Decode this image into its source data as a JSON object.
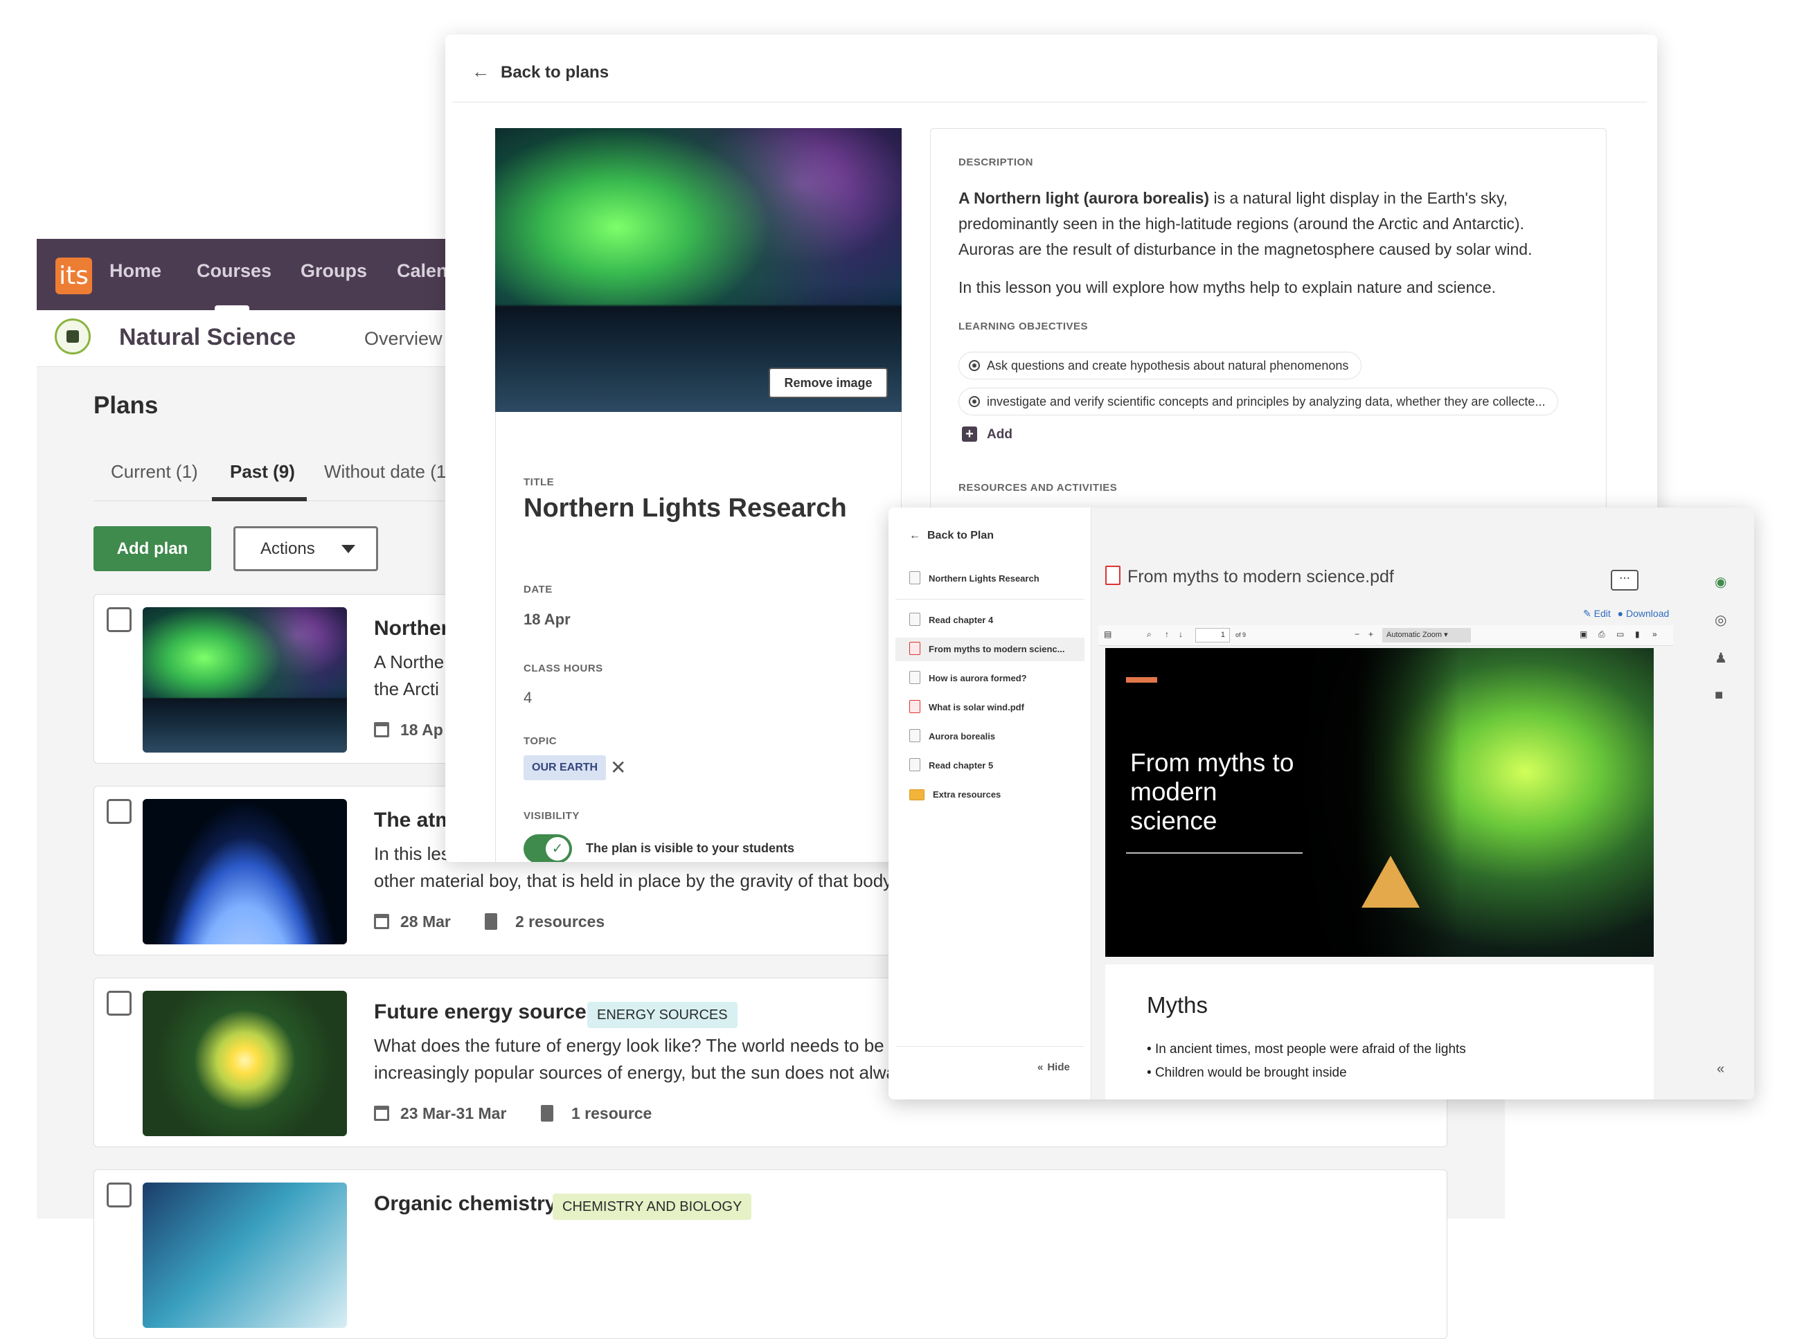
{
  "nav": {
    "logo": "its",
    "items": [
      "Home",
      "Courses",
      "Groups",
      "Calen"
    ]
  },
  "course": {
    "title": "Natural Science",
    "overview_tab": "Overview"
  },
  "plans": {
    "title": "Plans",
    "tabs": [
      "Current (1)",
      "Past (9)",
      "Without date (1"
    ],
    "add_label": "Add plan",
    "actions_label": "Actions",
    "cards": [
      {
        "title": "Norther",
        "desc": [
          "A Northe",
          "the Arcti"
        ],
        "date": "18 Ap"
      },
      {
        "title": "The atm",
        "desc": [
          "In this les",
          "other material boy, that is held in place by the gravity of that body"
        ],
        "date": "28 Mar",
        "resources": "2 resources"
      },
      {
        "title": "Future energy sources",
        "tag": "ENERGY SOURCES",
        "tag_bg": "#d8f0f1",
        "desc": [
          "What does the future of energy look like? The world needs to be",
          "increasingly popular sources of energy, but the sun does not alwa"
        ],
        "date": "23 Mar-31 Mar",
        "resources": "1 resource"
      },
      {
        "title": "Organic chemistry",
        "tag": "CHEMISTRY AND BIOLOGY",
        "tag_bg": "#e6f1c6"
      }
    ]
  },
  "editor": {
    "back_label": "Back to plans",
    "remove_image_label": "Remove image",
    "title_label": "TITLE",
    "title": "Northern Lights Research",
    "date_label": "DATE",
    "date": "18 Apr",
    "hours_label": "CLASS HOURS",
    "hours": "4",
    "topic_label": "TOPIC",
    "topic": "OUR EARTH",
    "visibility_label": "VISIBILITY",
    "visibility_text": "The plan is visible to your students",
    "visibility_on": true,
    "description_label": "DESCRIPTION",
    "description_bold": "A Northern light (aurora borealis)",
    "description_rest": " is a natural light display in the Earth's sky, predominantly seen in the high-latitude regions (around the Arctic and Antarctic). Auroras are the result of disturbance in the magnetosphere caused by solar wind.",
    "description_p2": "In this lesson you will explore how myths help to explain nature and science.",
    "objectives_label": "LEARNING OBJECTIVES",
    "objectives": [
      "Ask questions and create hypothesis about natural phenomenons",
      "investigate and verify scientific concepts and principles by analyzing data, whether they are collecte..."
    ],
    "add_label": "Add",
    "resources_label": "RESOURCES AND ACTIVITIES"
  },
  "viewer": {
    "back_label": "Back to Plan",
    "plan_name": "Northern Lights Research",
    "items": [
      {
        "label": "Read chapter 4",
        "kind": "task"
      },
      {
        "label": "From myths to modern scienc...",
        "kind": "pdf",
        "selected": true
      },
      {
        "label": "How is aurora formed?",
        "kind": "task"
      },
      {
        "label": "What is solar wind.pdf",
        "kind": "pdf"
      },
      {
        "label": "Aurora borealis",
        "kind": "image"
      },
      {
        "label": "Read chapter 5",
        "kind": "task"
      },
      {
        "label": "Extra resources",
        "kind": "folder"
      }
    ],
    "hide_label": "Hide",
    "file_name": "From myths to modern science.pdf",
    "more_label": "⋯",
    "edit_label": "Edit",
    "download_label": "Download",
    "page_current": "1",
    "page_total": "of 9",
    "zoom_label": "Automatic Zoom",
    "slide_title": "From myths to modern science",
    "slide2_heading": "Myths",
    "slide2_bullets": [
      "In ancient times, most people were afraid of the lights",
      "Children would be brought inside"
    ]
  },
  "colors": {
    "nav_bg": "#4c3c52",
    "logo": "#ee7d34",
    "primary_green": "#3f8a4d",
    "topic_tag": "#d8e2f3",
    "link_blue": "#2f6bbf"
  }
}
